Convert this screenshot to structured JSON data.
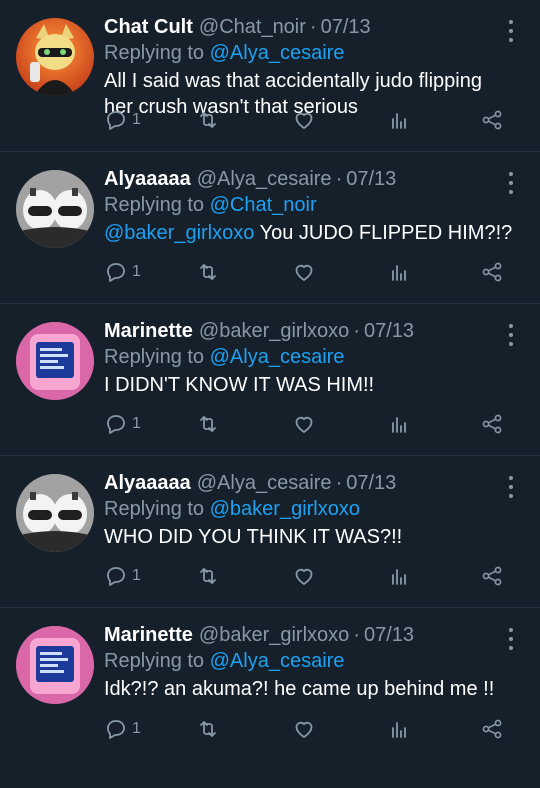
{
  "tweets": [
    {
      "name": "Chat Cult",
      "handle": "@Chat_noir",
      "date": "07/13",
      "replying_prefix": "Replying to",
      "replying_to": "@Alya_cesaire",
      "mention": "",
      "text": "All I said was that accidentally judo flipping her crush wasn't that serious",
      "reply_count": "1",
      "avatar_icon": "cartoon-cat-avatar"
    },
    {
      "name": "Alyaaaaa",
      "handle": "@Alya_cesaire",
      "date": "07/13",
      "replying_prefix": "Replying to",
      "replying_to": "@Chat_noir",
      "mention": "@baker_girlxoxo",
      "text": " You JUDO FLIPPED HIM?!?",
      "reply_count": "1",
      "avatar_icon": "helmets-avatar"
    },
    {
      "name": "Marinette",
      "handle": "@baker_girlxoxo",
      "date": "07/13",
      "replying_prefix": "Replying to",
      "replying_to": "@Alya_cesaire",
      "mention": "",
      "text": "I DIDN'T KNOW IT WAS HIM!!",
      "reply_count": "1",
      "avatar_icon": "pink-phone-avatar"
    },
    {
      "name": "Alyaaaaa",
      "handle": "@Alya_cesaire",
      "date": "07/13",
      "replying_prefix": "Replying to",
      "replying_to": "@baker_girlxoxo",
      "mention": "",
      "text": "WHO DID YOU THINK IT WAS?!!",
      "reply_count": "1",
      "avatar_icon": "helmets-avatar"
    },
    {
      "name": "Marinette",
      "handle": "@baker_girlxoxo",
      "date": "07/13",
      "replying_prefix": "Replying to",
      "replying_to": "@Alya_cesaire",
      "mention": "",
      "text": "Idk?!? an akuma?! he came up behind me !!",
      "reply_count": "1",
      "avatar_icon": "pink-phone-avatar"
    }
  ],
  "colors": {
    "background": "#15202b",
    "secondary_text": "#8899a6",
    "link": "#1da1f2",
    "divider": "#243342"
  }
}
